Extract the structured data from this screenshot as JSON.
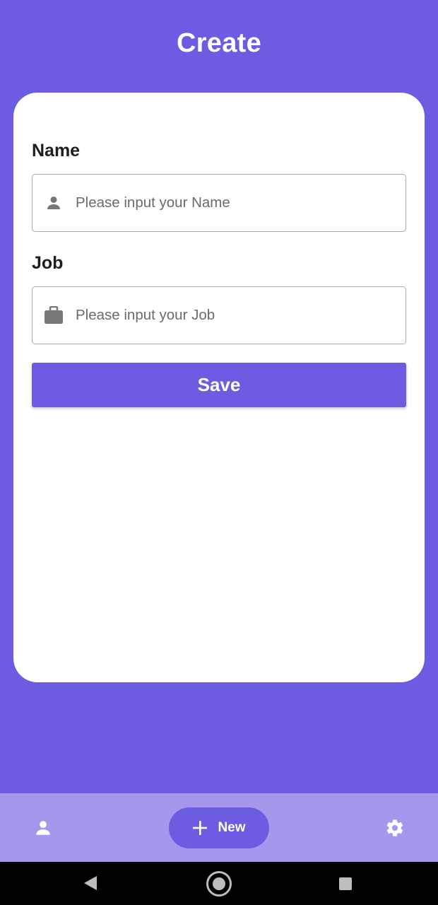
{
  "header": {
    "title": "Create"
  },
  "form": {
    "name": {
      "label": "Name",
      "placeholder": "Please input your Name",
      "icon": "person-icon"
    },
    "job": {
      "label": "Job",
      "placeholder": "Please input your Job",
      "icon": "briefcase-icon"
    },
    "save_label": "Save"
  },
  "bottom_nav": {
    "left_icon": "person-icon",
    "new_label": "New",
    "new_icon": "plus-icon",
    "right_icon": "gear-icon"
  },
  "system_nav": {
    "back_icon": "back-triangle-icon",
    "home_icon": "home-circle-icon",
    "recent_icon": "recent-square-icon"
  },
  "colors": {
    "primary": "#6c5ce2",
    "bottom_nav_bg": "#a598ec",
    "card_bg": "#ffffff",
    "input_border": "#a8a8a8",
    "placeholder": "#6b6b6b",
    "system_bar": "#000000"
  }
}
